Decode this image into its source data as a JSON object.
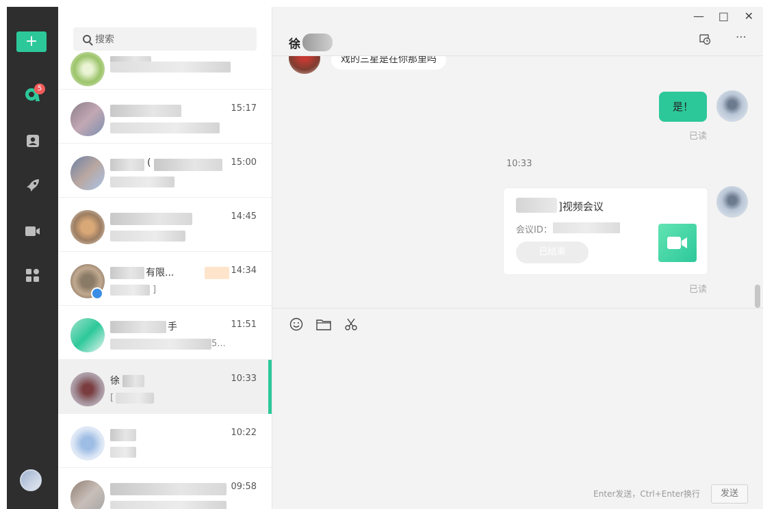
{
  "rail": {
    "plus_label": "+",
    "badge_count": "5",
    "icons": [
      "app-logo-icon",
      "contacts-icon",
      "rocket-icon",
      "video-icon",
      "apps-icon"
    ]
  },
  "search": {
    "placeholder": "搜索"
  },
  "conversations": [
    {
      "time": "",
      "name_visible": "",
      "preview_visible": ""
    },
    {
      "time": "15:17",
      "name_visible": "",
      "preview_visible": ""
    },
    {
      "time": "15:00",
      "name_visible": "(",
      "preview_visible": ""
    },
    {
      "time": "14:45",
      "name_visible": "",
      "preview_visible": ""
    },
    {
      "time": "14:34",
      "name_visible": "有限...",
      "preview_visible": "]"
    },
    {
      "time": "11:51",
      "name_visible": "手",
      "preview_visible": "5..."
    },
    {
      "time": "10:33",
      "name_visible": "徐",
      "preview_visible": "["
    },
    {
      "time": "10:22",
      "name_visible": "",
      "preview_visible": ""
    },
    {
      "time": "09:58",
      "name_visible": "",
      "preview_visible": ""
    }
  ],
  "chat": {
    "title": "徐",
    "window_controls": [
      "—",
      "□",
      "✕"
    ],
    "incoming_text": "戏的三星是在你那里吗",
    "outgoing_text": "是！",
    "read_label": "已读",
    "timestamp": "10:33",
    "card": {
      "title": "]视频会议",
      "id_label": "会议ID：",
      "status": "已结束"
    },
    "read_label_2": "已读",
    "input_hint": "Enter发送，Ctrl+Enter换行",
    "send_label": "发送"
  }
}
